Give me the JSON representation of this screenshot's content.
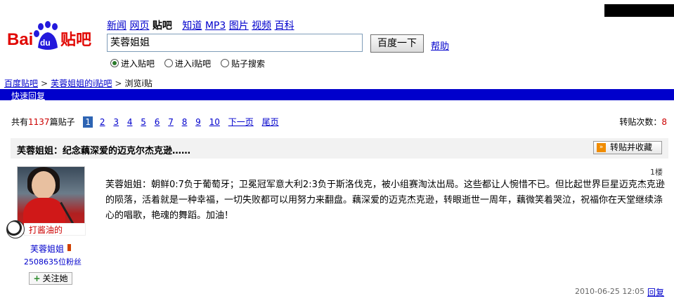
{
  "nav": {
    "links": [
      "新闻",
      "网页",
      "贴吧",
      "知道",
      "MP3",
      "图片",
      "视频",
      "百科"
    ],
    "current_index": 2
  },
  "logo": {
    "text_left": "Bai",
    "paw_text": "du",
    "text_right": "贴吧"
  },
  "search": {
    "value": "芙蓉姐姐",
    "button": "百度一下",
    "help": "帮助"
  },
  "search_options": [
    "进入贴吧",
    "进入i贴吧",
    "贴子搜索"
  ],
  "breadcrumb": [
    "百度贴吧",
    "芙蓉姐姐的i贴吧",
    "浏览i贴"
  ],
  "quick_reply": "快速回复",
  "pager": {
    "prefix": "共有",
    "count": "1137",
    "suffix": "篇贴子",
    "pages": [
      "1",
      "2",
      "3",
      "4",
      "5",
      "6",
      "7",
      "8",
      "9",
      "10"
    ],
    "next": "下一页",
    "last": "尾页"
  },
  "reposts": {
    "label": "转贴次数：",
    "value": "8"
  },
  "post": {
    "title": "芙蓉姐姐：纪念藕深爱的迈克尔杰克逊……",
    "forward_button": "转贴并收藏",
    "floor": "1楼",
    "content": "芙蓉姐姐：朝鲜0:7负于葡萄牙；卫冕冠军意大利2:3负于斯洛伐克，被小组赛淘汰出局。这些都让人惋惜不已。但比起世界巨星迈克杰克逊的陨落，活着就是一种幸福，一切失败都可以用努力来翻盘。藕深爱的迈克杰克逊，转眼逝世一周年，藕微笑着哭泣，祝福你在天堂继续涤心的唱歌，艳魂的舞蹈。加油！",
    "date": "2010-06-25 12:05",
    "reply": "回复"
  },
  "author": {
    "badge": "打酱油的",
    "name": "芙蓉姐姐",
    "fans": "2508635位粉丝",
    "follow": "关注她"
  },
  "colors": {
    "bar": "#0000cc",
    "link": "#0000cc",
    "accent": "#cc0000"
  }
}
